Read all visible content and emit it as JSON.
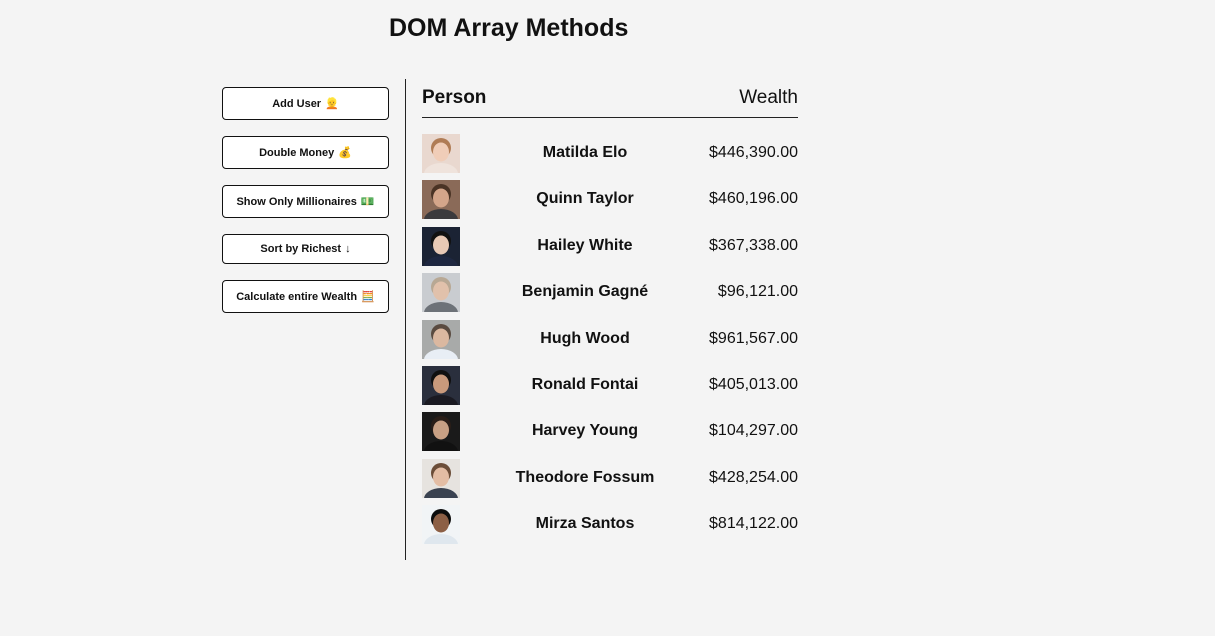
{
  "header": {
    "title": "DOM Array Methods"
  },
  "sidebar": {
    "buttons": [
      {
        "label": "Add User",
        "icon_char": "👱",
        "icon": "person-icon"
      },
      {
        "label": "Double Money",
        "icon_char": "💰",
        "icon": "money-bag-icon"
      },
      {
        "label": "Show Only Millionaires",
        "icon_char": "💵",
        "icon": "cash-icon"
      },
      {
        "label": "Sort by Richest",
        "icon_char": "↓",
        "icon": "arrow-down-icon"
      },
      {
        "label": "Calculate entire Wealth",
        "icon_char": "🧮",
        "icon": "abacus-icon"
      }
    ]
  },
  "table": {
    "columns": {
      "person": "Person",
      "wealth": "Wealth"
    },
    "rows": [
      {
        "name": "Matilda Elo",
        "wealth": "$446,390.00",
        "avatar": {
          "bg": "#e9d8cf",
          "hair": "#b07c55",
          "skin": "#f0cdb8",
          "shirt": "#efe3dc"
        }
      },
      {
        "name": "Quinn Taylor",
        "wealth": "$460,196.00",
        "avatar": {
          "bg": "#8a6a58",
          "hair": "#4a3325",
          "skin": "#d4a58a",
          "shirt": "#3b3a3d"
        }
      },
      {
        "name": "Hailey White",
        "wealth": "$367,338.00",
        "avatar": {
          "bg": "#1b2334",
          "hair": "#111111",
          "skin": "#e8c9b5",
          "shirt": "#1e2740"
        }
      },
      {
        "name": "Benjamin Gagné",
        "wealth": "$96,121.00",
        "avatar": {
          "bg": "#c9ccd0",
          "hair": "#b8a894",
          "skin": "#e1c1ab",
          "shirt": "#6d7278"
        }
      },
      {
        "name": "Hugh Wood",
        "wealth": "$961,567.00",
        "avatar": {
          "bg": "#a8aaa9",
          "hair": "#5a4b40",
          "skin": "#dbb8a0",
          "shirt": "#e8eef5"
        }
      },
      {
        "name": "Ronald Fontai",
        "wealth": "$405,013.00",
        "avatar": {
          "bg": "#2a2f3d",
          "hair": "#101010",
          "skin": "#c99a7c",
          "shirt": "#1a1a22"
        }
      },
      {
        "name": "Harvey Young",
        "wealth": "$104,297.00",
        "avatar": {
          "bg": "#1a1a1a",
          "hair": "#2a1e18",
          "skin": "#c8a084",
          "shirt": "#111111"
        }
      },
      {
        "name": "Theodore Fossum",
        "wealth": "$428,254.00",
        "avatar": {
          "bg": "#e6e3df",
          "hair": "#6b4d38",
          "skin": "#e3bda4",
          "shirt": "#3a4250"
        }
      },
      {
        "name": "Mirza Santos",
        "wealth": "$814,122.00",
        "avatar": {
          "bg": "#f1f4f6",
          "hair": "#0c0c0c",
          "skin": "#8c5f45",
          "shirt": "#dfe7ee"
        }
      }
    ]
  }
}
